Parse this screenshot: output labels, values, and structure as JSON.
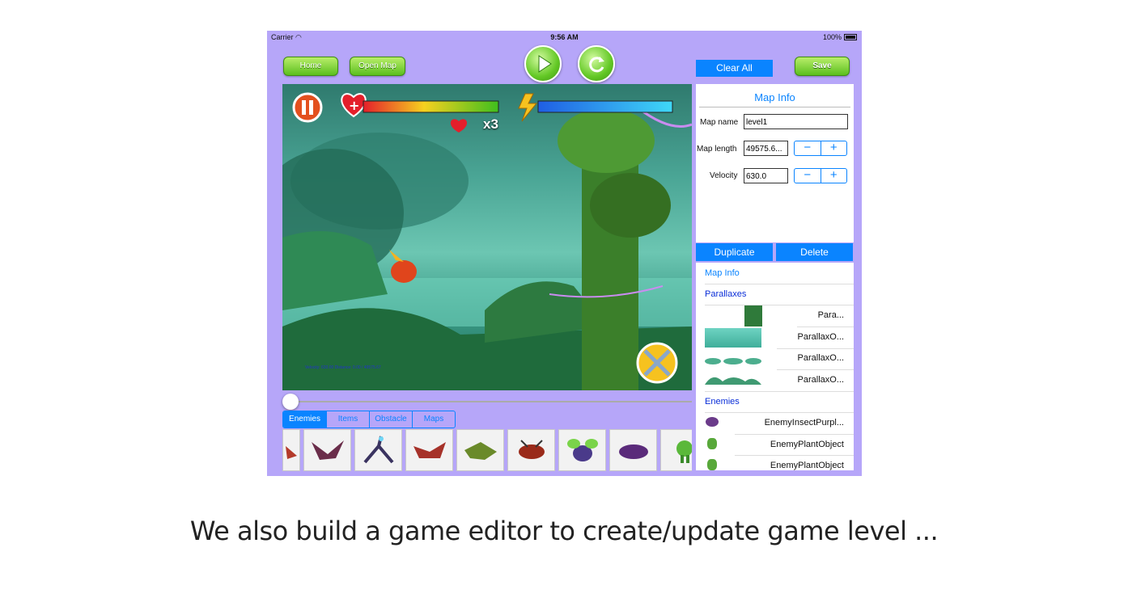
{
  "status_bar": {
    "carrier": "Carrier",
    "time": "9:56 AM",
    "battery": "100%"
  },
  "toolbar": {
    "home_label": "Home",
    "open_map_label": "Open Map",
    "clear_all_label": "Clear All",
    "save_label": "Save"
  },
  "hud": {
    "lives": "x3",
    "velocity_readout": "Velocity: 630.00 Distance: 0.00 / 49575.67"
  },
  "map_info": {
    "title": "Map Info",
    "map_name_label": "Map name",
    "map_name_value": "level1",
    "map_length_label": "Map length",
    "map_length_value": "49575.6...",
    "velocity_label": "Velocity",
    "velocity_value": "630.0",
    "minus": "−",
    "plus": "+"
  },
  "actions": {
    "duplicate_label": "Duplicate",
    "delete_label": "Delete"
  },
  "tree": {
    "map_info": "Map Info",
    "parallaxes_header": "Parallaxes",
    "parallaxes": [
      "Para...",
      "ParallaxO...",
      "ParallaxO...",
      "ParallaxO..."
    ],
    "enemies_header": "Enemies",
    "enemies": [
      "EnemyInsectPurpl...",
      "EnemyPlantObject",
      "EnemyPlantObject"
    ]
  },
  "tabs": [
    "Enemies",
    "Items",
    "Obstacle",
    "Maps"
  ],
  "palette_count": 9,
  "caption": "We also build a game editor to create/update game level ...",
  "colors": {
    "device_bg": "#b6a6f9",
    "accent_blue": "#0a84ff",
    "green_button": "#5bbf1e"
  }
}
